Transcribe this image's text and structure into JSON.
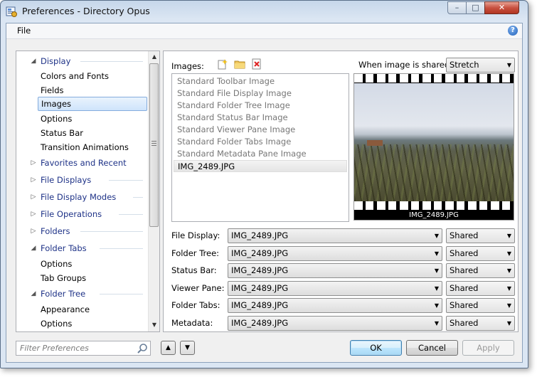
{
  "window": {
    "title": "Preferences - Directory Opus",
    "buttons": {
      "minimize": "–",
      "maximize": "□",
      "close": "✕"
    }
  },
  "menu": {
    "file": "File",
    "help_icon": "?"
  },
  "tree": {
    "items": [
      {
        "label": "Display",
        "type": "category",
        "expanded": true
      },
      {
        "label": "Colors and Fonts",
        "type": "child"
      },
      {
        "label": "Fields",
        "type": "child"
      },
      {
        "label": "Images",
        "type": "child",
        "selected": true
      },
      {
        "label": "Options",
        "type": "child"
      },
      {
        "label": "Status Bar",
        "type": "child"
      },
      {
        "label": "Transition Animations",
        "type": "child"
      },
      {
        "label": "Favorites and Recent",
        "type": "category",
        "expanded": false
      },
      {
        "label": "File Displays",
        "type": "category",
        "expanded": false
      },
      {
        "label": "File Display Modes",
        "type": "category",
        "expanded": false
      },
      {
        "label": "File Operations",
        "type": "category",
        "expanded": false
      },
      {
        "label": "Folders",
        "type": "category",
        "expanded": false
      },
      {
        "label": "Folder Tabs",
        "type": "category",
        "expanded": true
      },
      {
        "label": "Options",
        "type": "child"
      },
      {
        "label": "Tab Groups",
        "type": "child"
      },
      {
        "label": "Folder Tree",
        "type": "category",
        "expanded": true
      },
      {
        "label": "Appearance",
        "type": "child"
      },
      {
        "label": "Options",
        "type": "child"
      }
    ]
  },
  "images": {
    "label": "Images:",
    "toolbar_icons": [
      "new-image-icon",
      "open-folder-icon",
      "delete-icon"
    ],
    "shared_label": "When image is shared,",
    "shared_mode": "Stretch",
    "list": [
      "Standard Toolbar Image",
      "Standard File Display Image",
      "Standard Folder Tree Image",
      "Standard Status Bar Image",
      "Standard Viewer Pane Image",
      "Standard Folder Tabs Image",
      "Standard Metadata Pane Image",
      "IMG_2489.JPG"
    ],
    "selected": "IMG_2489.JPG",
    "preview_caption": "IMG_2489.JPG"
  },
  "assignments": [
    {
      "label": "File Display:",
      "image": "IMG_2489.JPG",
      "mode": "Shared"
    },
    {
      "label": "Folder Tree:",
      "image": "IMG_2489.JPG",
      "mode": "Shared"
    },
    {
      "label": "Status Bar:",
      "image": "IMG_2489.JPG",
      "mode": "Shared"
    },
    {
      "label": "Viewer Pane:",
      "image": "IMG_2489.JPG",
      "mode": "Shared"
    },
    {
      "label": "Folder Tabs:",
      "image": "IMG_2489.JPG",
      "mode": "Shared"
    },
    {
      "label": "Metadata:",
      "image": "IMG_2489.JPG",
      "mode": "Shared"
    }
  ],
  "filter": {
    "placeholder": "Filter Preferences"
  },
  "buttons": {
    "ok": "OK",
    "cancel": "Cancel",
    "apply": "Apply"
  },
  "colors": {
    "category_text": "#1e3287",
    "accent": "#3c7fb1"
  }
}
